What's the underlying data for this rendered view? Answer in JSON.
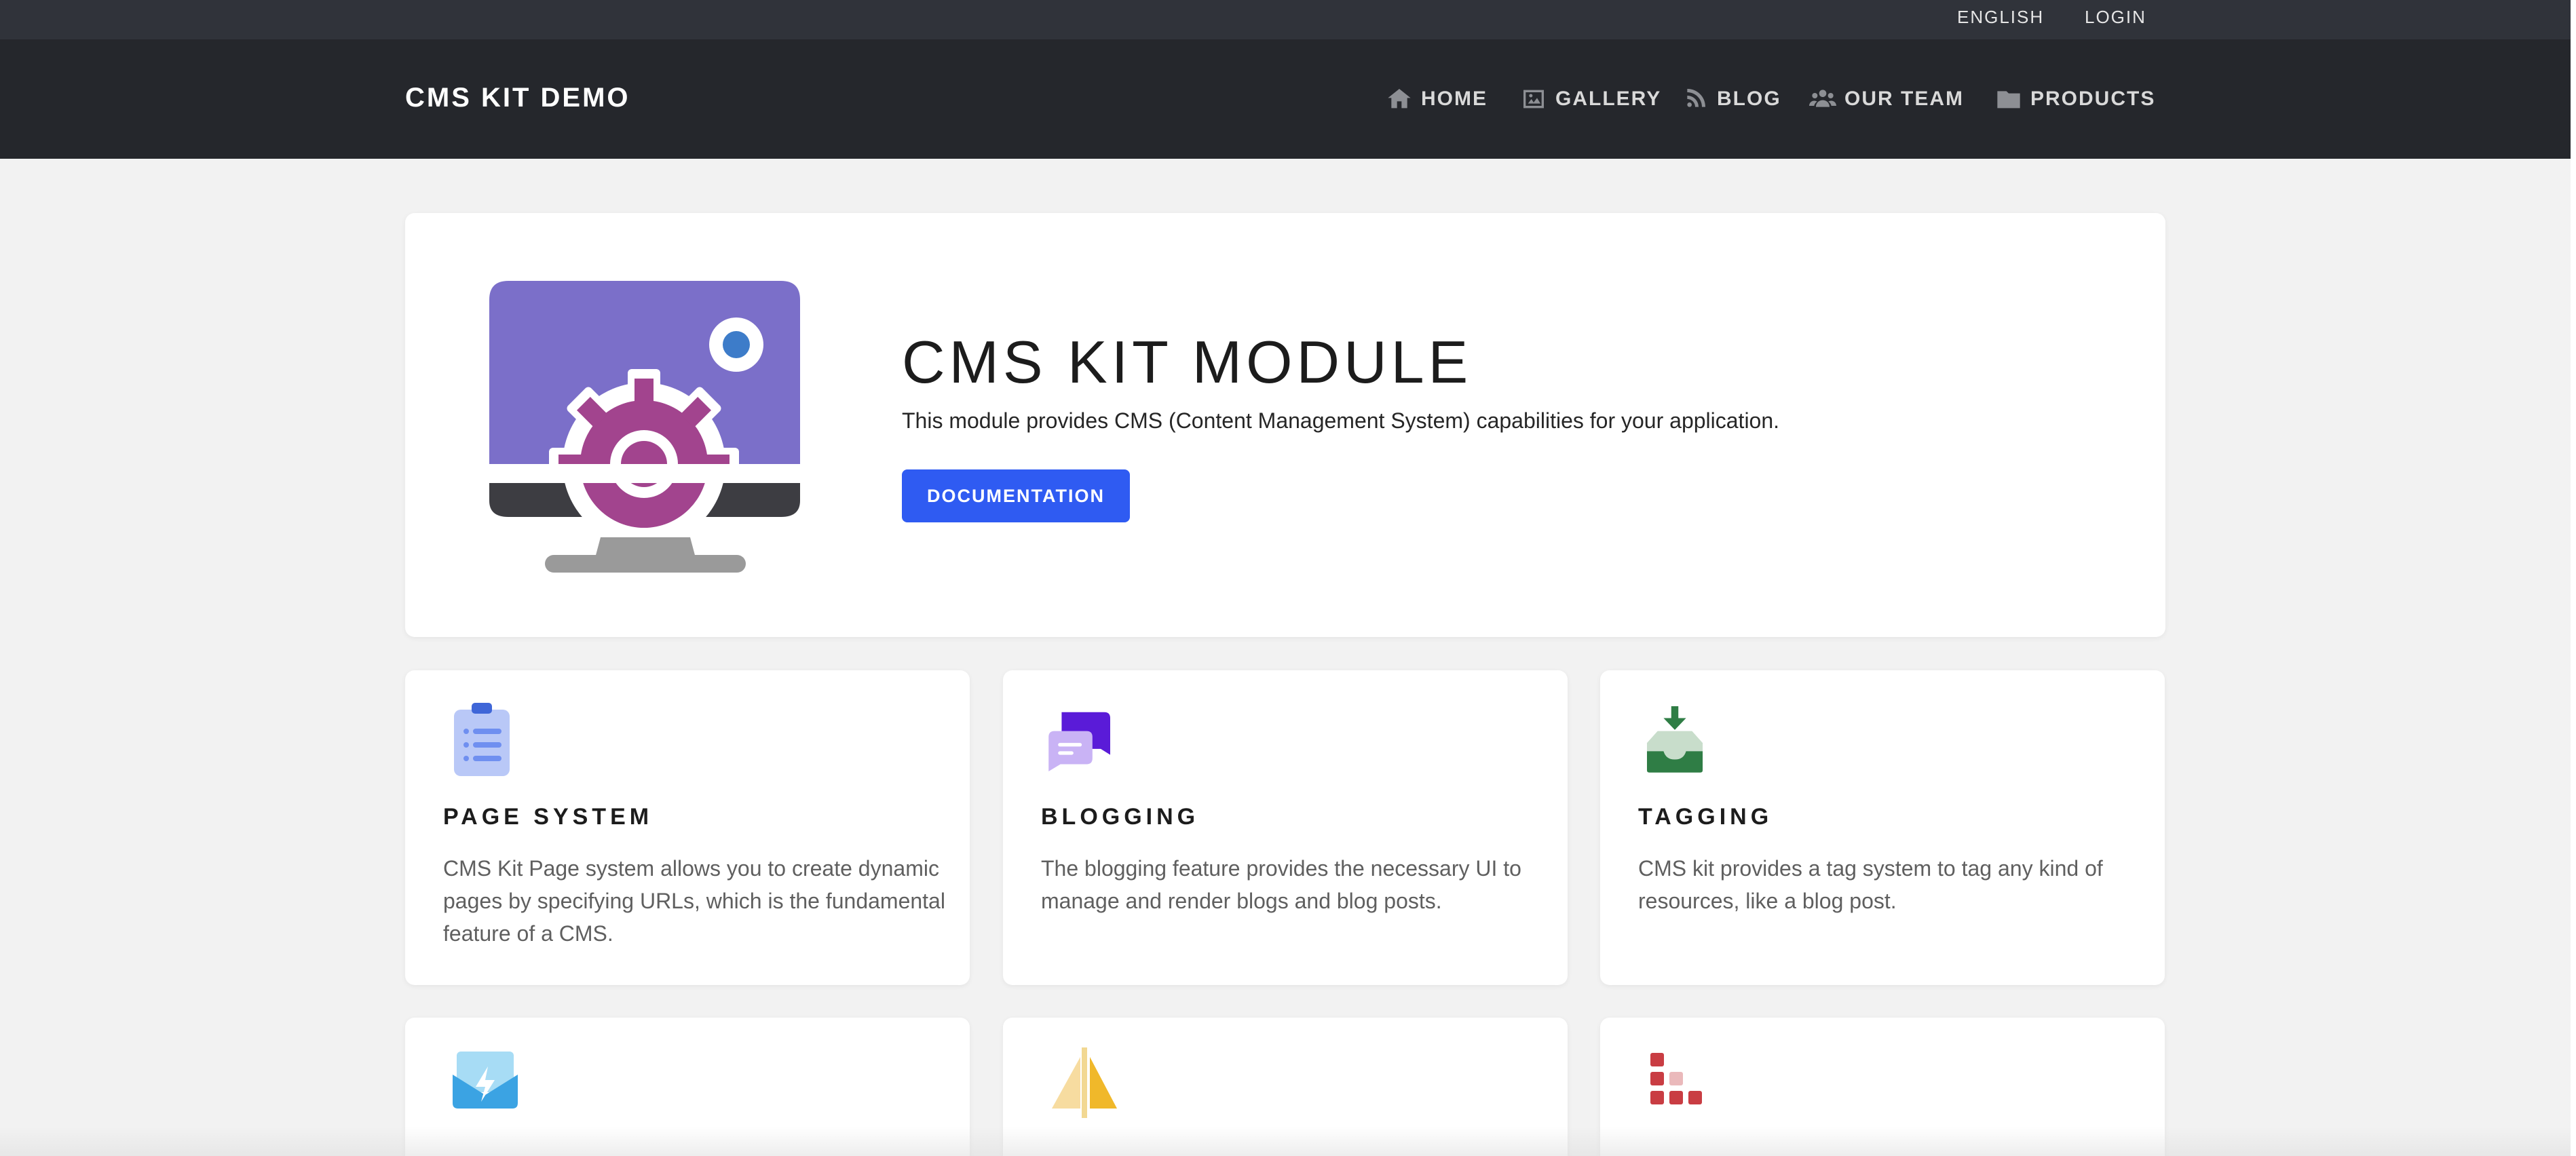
{
  "topbar": {
    "language": "ENGLISH",
    "login": "LOGIN"
  },
  "navbar": {
    "brand": "CMS KIT DEMO",
    "items": [
      {
        "label": "HOME",
        "icon": "home-icon"
      },
      {
        "label": "GALLERY",
        "icon": "image-icon"
      },
      {
        "label": "BLOG",
        "icon": "blog-icon"
      },
      {
        "label": "OUR TEAM",
        "icon": "users-icon"
      },
      {
        "label": "PRODUCTS",
        "icon": "folder-icon"
      }
    ]
  },
  "hero": {
    "title": "CMS KIT MODULE",
    "description": "This module provides CMS (Content Management System) capabilities for your application.",
    "button": "DOCUMENTATION",
    "image_icon": "monitor-gear-icon"
  },
  "features": [
    {
      "title": "PAGE SYSTEM",
      "description": "CMS Kit Page system allows you to create dynamic pages by specifying URLs, which is the fundamental feature of a CMS.",
      "icon": "clipboard-list-icon"
    },
    {
      "title": "BLOGGING",
      "description": "The blogging feature provides the necessary UI to manage and render blogs and blog posts.",
      "icon": "chat-bubbles-icon"
    },
    {
      "title": "TAGGING",
      "description": "CMS kit provides a tag system to tag any kind of resources, like a blog post.",
      "icon": "inbox-download-icon"
    },
    {
      "title": "",
      "description": "",
      "icon": "lightning-envelope-icon"
    },
    {
      "title": "",
      "description": "",
      "icon": "split-triangle-icon"
    },
    {
      "title": "",
      "description": "",
      "icon": "dot-grid-icon"
    }
  ],
  "colors": {
    "topbar": "#30333a",
    "navbar": "#25272c",
    "accent": "#2f5bf2",
    "background": "#f2f2f2"
  }
}
